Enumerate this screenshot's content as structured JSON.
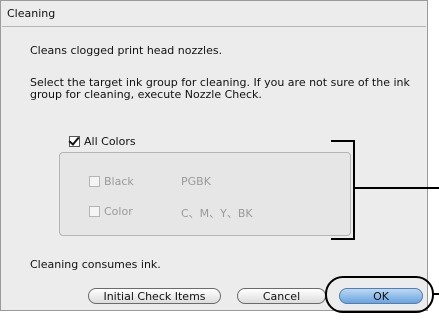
{
  "dialog": {
    "title": "Cleaning",
    "description": "Cleans clogged print head nozzles.",
    "instruction": "Select the target ink group for cleaning. If you are not sure of the ink group for cleaning, execute Nozzle Check.",
    "all_colors_label": "All Colors",
    "all_colors_checked": true,
    "options": [
      {
        "label": "Black",
        "code": "PGBK",
        "checked": false,
        "enabled": false
      },
      {
        "label": "Color",
        "code": "C、M、Y、BK",
        "checked": false,
        "enabled": false
      }
    ],
    "note": "Cleaning consumes ink.",
    "buttons": {
      "initial_check": "Initial Check Items",
      "cancel": "Cancel",
      "ok": "OK"
    }
  }
}
